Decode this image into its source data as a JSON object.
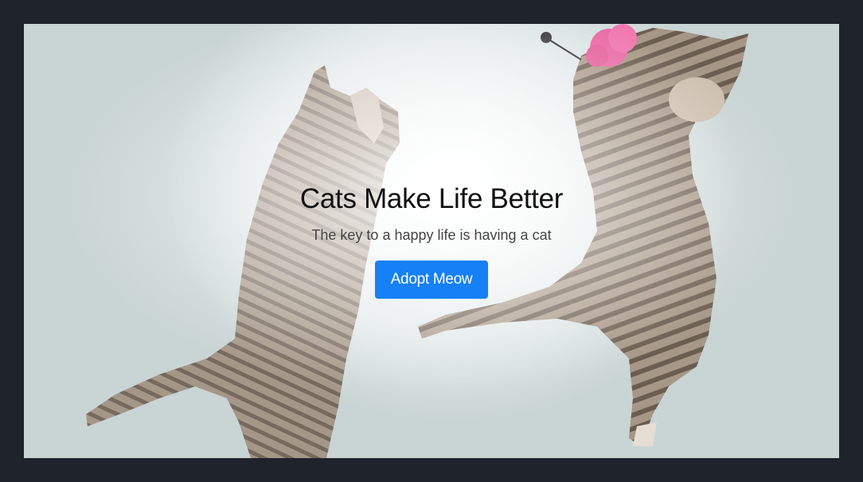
{
  "hero": {
    "title": "Cats Make Life Better",
    "subtitle": "The key to a happy life is having a cat",
    "button_label": "Adopt Meow"
  },
  "colors": {
    "page_background": "#1f232b",
    "button": "#1680f5",
    "button_text": "#ffffff",
    "title_text": "#111111",
    "subtitle_text": "#444444"
  },
  "images": {
    "background": "two-tabby-cats-jumping-playing-with-pink-toy"
  }
}
